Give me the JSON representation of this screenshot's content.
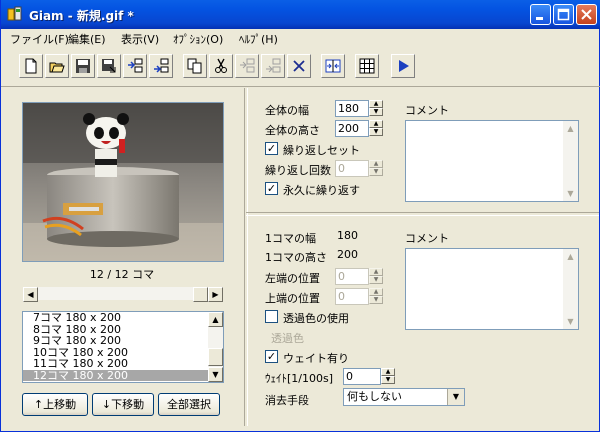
{
  "window": {
    "title": "Giam - 新規.gif *"
  },
  "menubar": {
    "items": [
      {
        "label": "ファイル(F)"
      },
      {
        "label": "編集(E)"
      },
      {
        "label": "表示(V)"
      },
      {
        "label": "ｵﾌﾟｼｮﾝ(O)"
      },
      {
        "label": "ﾍﾙﾌﾟ(H)"
      }
    ]
  },
  "toolbar": {
    "buttons": [
      "new-file-icon",
      "open-folder-icon",
      "save-icon",
      "save-as-icon",
      "insert-before-icon",
      "insert-after-icon",
      "copy-icon",
      "cut-icon",
      "paste-disabled-icon",
      "paste-after-disabled-icon",
      "delete-icon",
      "split-icon",
      "grid-icon",
      "play-icon"
    ]
  },
  "preview": {
    "frame_info": "12 / 12 コマ"
  },
  "frame_list": {
    "items": [
      "7コマ 180 x 200",
      "8コマ 180 x 200",
      "9コマ 180 x 200",
      "10コマ 180 x 200",
      "11コマ 180 x 200",
      "12コマ 180 x 200"
    ],
    "selected_index": 5
  },
  "buttons": {
    "move_up": "↑上移動",
    "move_down": "↓下移動",
    "select_all": "全部選択"
  },
  "global": {
    "width_label": "全体の幅",
    "width_value": "180",
    "height_label": "全体の高さ",
    "height_value": "200",
    "loop_set_label": "繰り返しセット",
    "loop_set_checked": true,
    "loop_count_label": "繰り返し回数",
    "loop_count_value": "0",
    "loop_forever_label": "永久に繰り返す",
    "loop_forever_checked": true,
    "comment_label": "コメント"
  },
  "frame": {
    "width_label": "1コマの幅",
    "width_value": "180",
    "height_label": "1コマの高さ",
    "height_value": "200",
    "left_label": "左端の位置",
    "left_value": "0",
    "top_label": "上端の位置",
    "top_value": "0",
    "transparent_label": "透過色の使用",
    "transparent_checked": false,
    "transparent_color_label": "透過色",
    "wait_label": "ウェイト有り",
    "wait_checked": true,
    "wait_time_label": "ｳｪｲﾄ[1/100s]",
    "wait_time_value": "0",
    "disposal_label": "消去手段",
    "disposal_value": "何もしない",
    "comment_label": "コメント"
  }
}
